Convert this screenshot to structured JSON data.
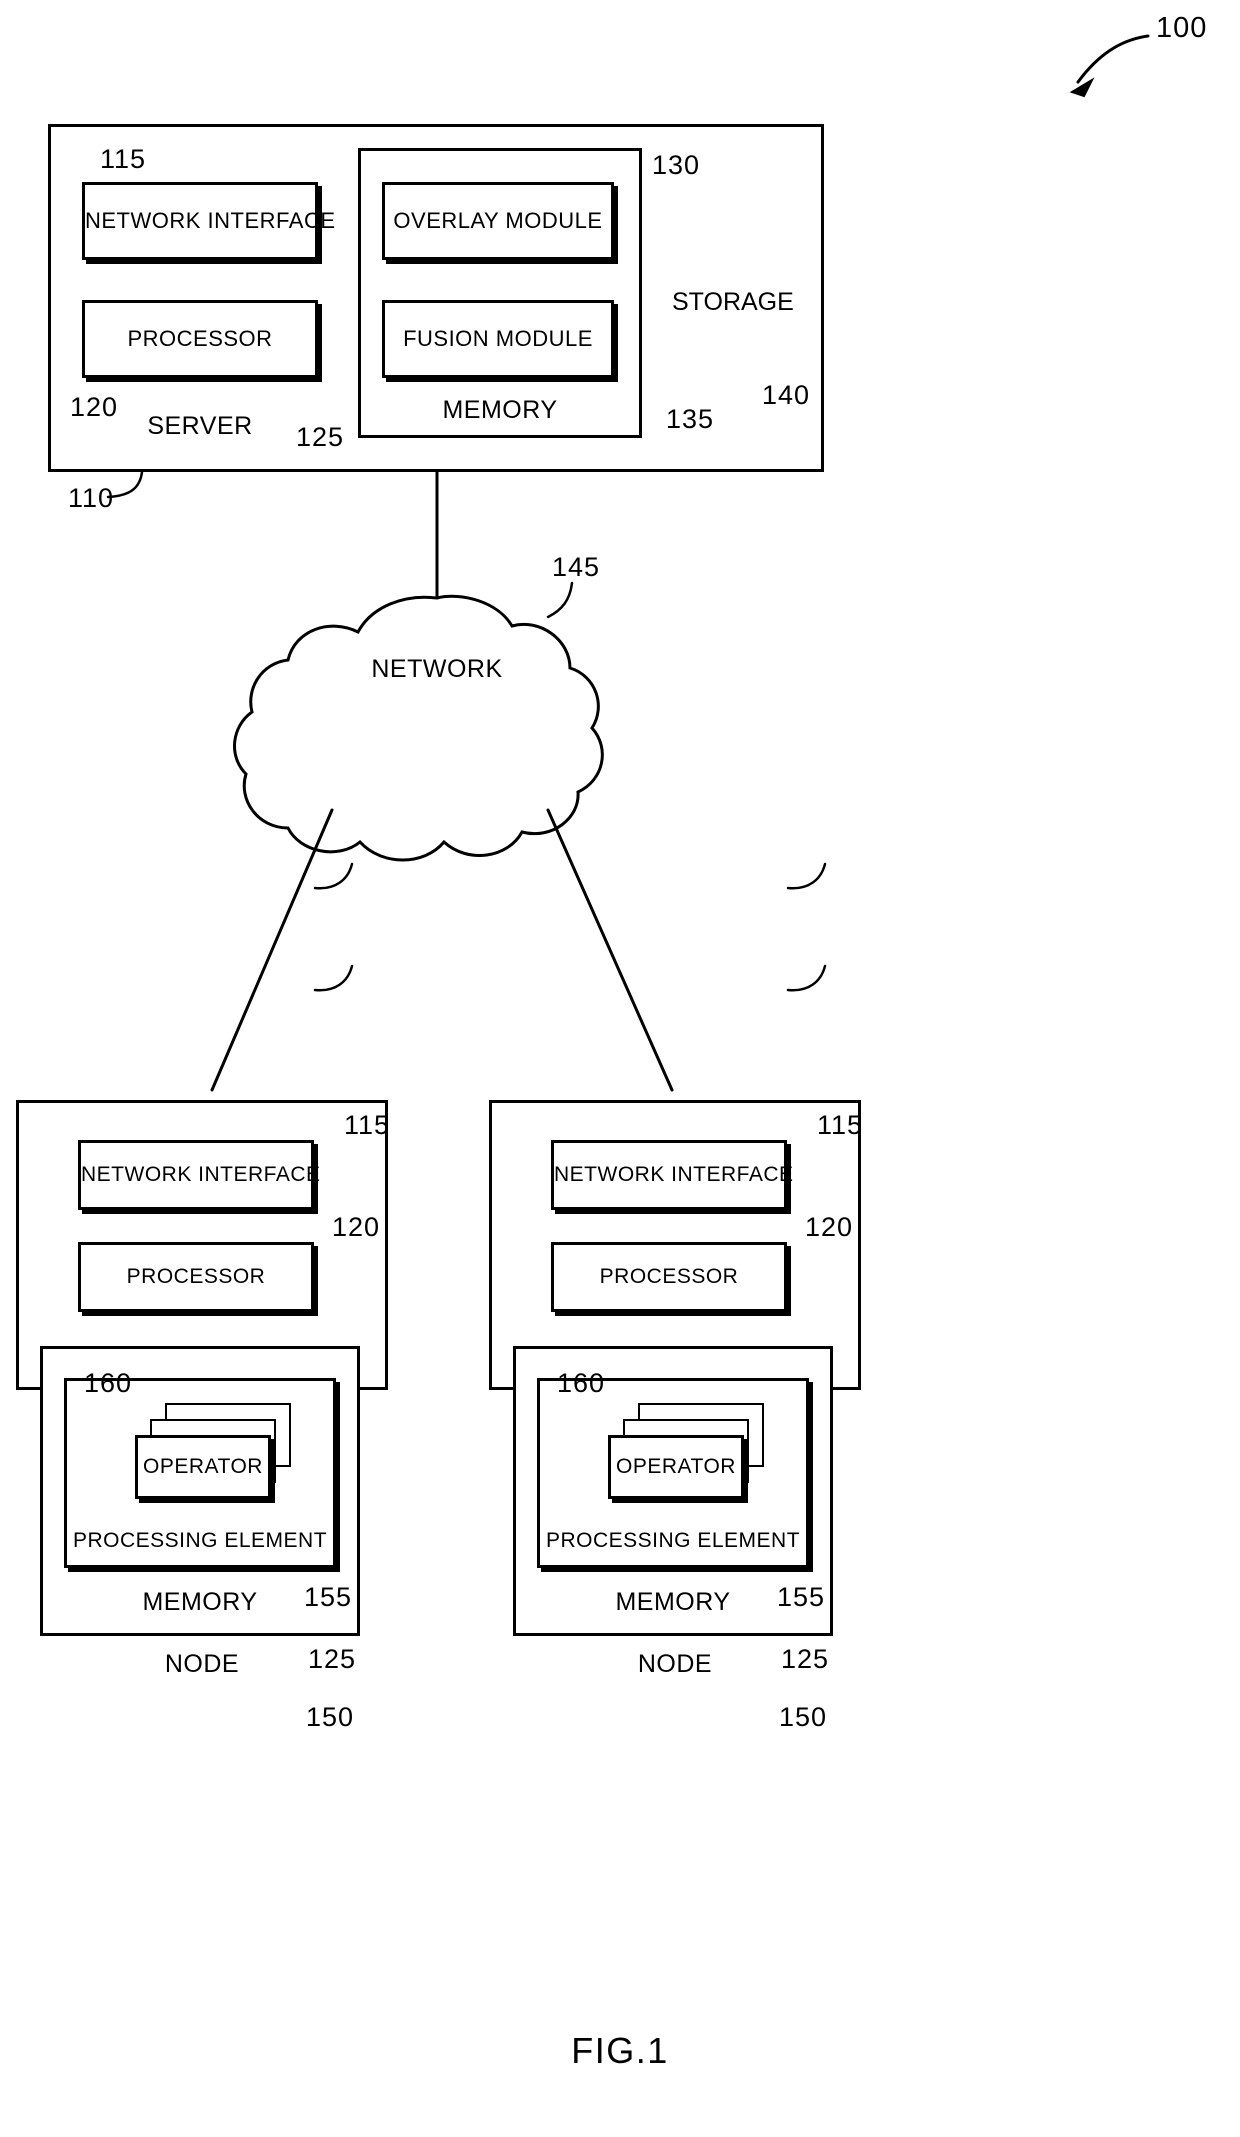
{
  "figure": {
    "caption": "FIG.1",
    "system_ref": "100"
  },
  "server": {
    "title": "SERVER",
    "ref": "110",
    "network_interface": {
      "label": "NETWORK INTERFACE",
      "ref": "115"
    },
    "processor": {
      "label": "PROCESSOR",
      "ref": "120"
    },
    "memory": {
      "label": "MEMORY",
      "ref": "125",
      "overlay_module": {
        "label": "OVERLAY MODULE",
        "ref": "130"
      },
      "fusion_module": {
        "label": "FUSION MODULE",
        "ref": "135"
      }
    },
    "storage": {
      "label": "STORAGE",
      "ref": "140"
    }
  },
  "network": {
    "label": "NETWORK",
    "ref": "145"
  },
  "nodes": [
    {
      "title": "NODE",
      "ref": "150",
      "network_interface": {
        "label": "NETWORK INTERFACE",
        "ref": "115"
      },
      "processor": {
        "label": "PROCESSOR",
        "ref": "120"
      },
      "memory": {
        "label": "MEMORY",
        "ref": "155",
        "node_ref": "125",
        "processing_element": {
          "label": "PROCESSING ELEMENT",
          "operator": {
            "label": "OPERATOR",
            "ref": "160"
          }
        }
      }
    },
    {
      "title": "NODE",
      "ref": "150",
      "network_interface": {
        "label": "NETWORK INTERFACE",
        "ref": "115"
      },
      "processor": {
        "label": "PROCESSOR",
        "ref": "120"
      },
      "memory": {
        "label": "MEMORY",
        "ref": "155",
        "node_ref": "125",
        "processing_element": {
          "label": "PROCESSING ELEMENT",
          "operator": {
            "label": "OPERATOR",
            "ref": "160"
          }
        }
      }
    }
  ],
  "colors": {
    "ink": "#000000",
    "paper": "#ffffff"
  }
}
